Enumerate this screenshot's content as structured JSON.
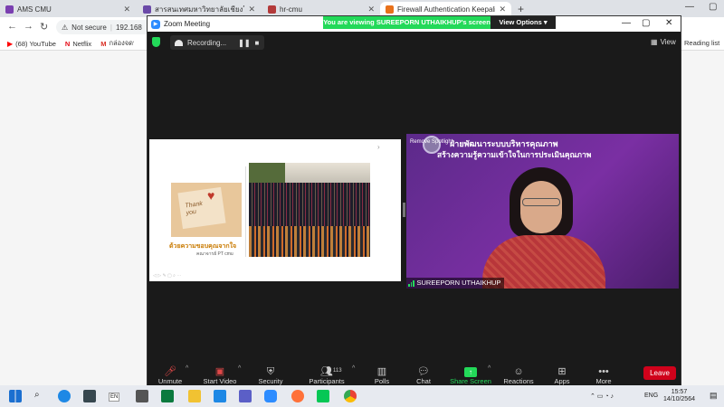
{
  "browser": {
    "tabs": [
      {
        "title": "AMS CMU",
        "color": "#7a3fb0"
      },
      {
        "title": "สารสนเทศมหาวิทยาลัยเชียงใหม่ : ทำไม่",
        "color": "#6b4aa8"
      },
      {
        "title": "hr-cmu",
        "color": "#b33a3a"
      },
      {
        "title": "Firewall Authentication Keepalive",
        "color": "#e8711a"
      }
    ],
    "new_tab": "+",
    "address": {
      "security": "Not secure",
      "url": "192.168"
    },
    "paused_label": "aused",
    "bookmarks": [
      {
        "label": "(68) YouTube",
        "icon": "youtube-icon",
        "color": "#ff0000"
      },
      {
        "label": "Netflix",
        "icon": "netflix-icon",
        "color": "#e50914"
      },
      {
        "label": "กล่องจดหมาย",
        "icon": "gmail-icon",
        "color": "#d93025"
      }
    ],
    "reading_list": "Reading list"
  },
  "zoom": {
    "title": "Zoom Meeting",
    "viewing_banner": "You are viewing SUREEPORN UTHAIKHUP's screen",
    "view_options": "View Options ▾",
    "recording": "Recording...",
    "view_label": "View",
    "slide": {
      "caption": "ด้วยความขอบคุณจากใจ",
      "sub_caption": "คณาจารย์ PT cmu",
      "card_text": "Thank you"
    },
    "video": {
      "title_line1": "ฝ่ายพัฒนาระบบบริหารคุณภาพ",
      "title_line2": "สร้างความรู้ความเข้าใจในการประเมินคุณภาพ",
      "spotlight": "Remove Spotlight",
      "participant_name": "SUREEPORN UTHAIKHUP"
    },
    "toolbar": {
      "unmute": "Unmute",
      "start_video": "Start Video",
      "security": "Security",
      "participants": "Participants",
      "participants_count": "113",
      "polls": "Polls",
      "chat": "Chat",
      "share_screen": "Share Screen",
      "reactions": "Reactions",
      "apps": "Apps",
      "more": "More",
      "leave": "Leave"
    }
  },
  "taskbar": {
    "lang": "ENG",
    "time": "15:57",
    "date": "14/10/2564",
    "en_badge": "EN"
  }
}
